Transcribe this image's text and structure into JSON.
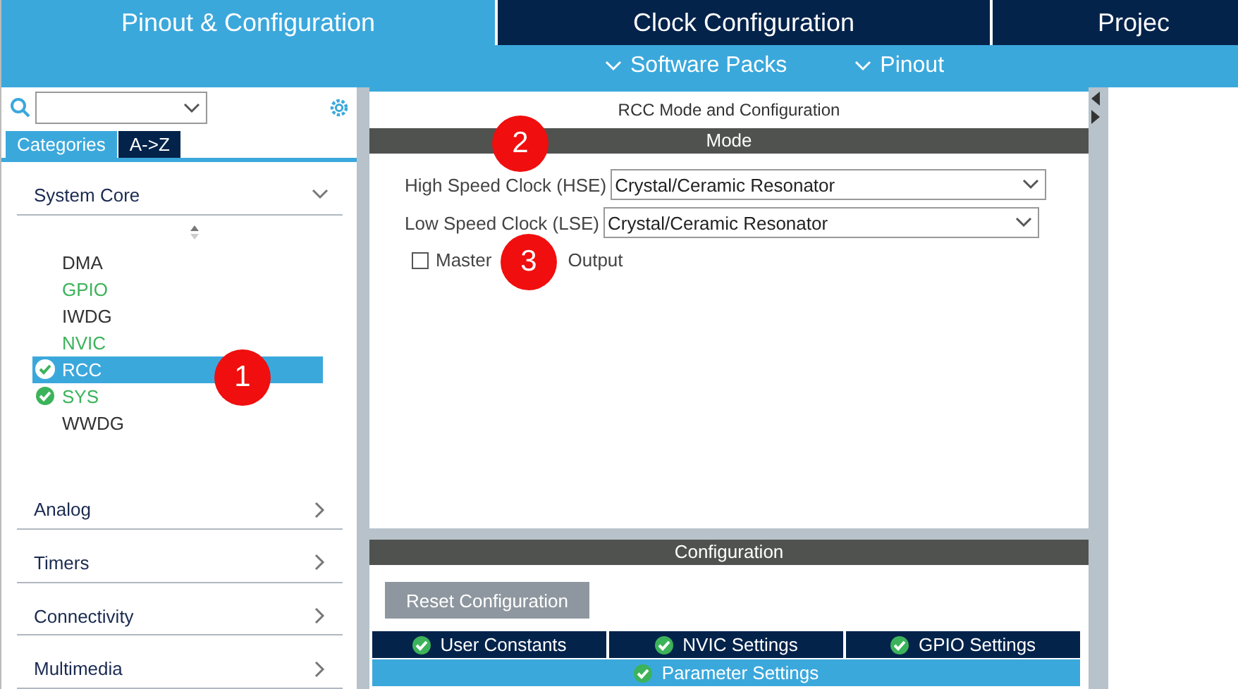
{
  "main_tabs": [
    {
      "label": "Pinout & Configuration",
      "selected": true
    },
    {
      "label": "Clock Configuration",
      "selected": false
    },
    {
      "label": "Projec",
      "selected": false
    }
  ],
  "sub_menu": [
    "Software Packs",
    "Pinout"
  ],
  "sidebar": {
    "view_tabs": [
      {
        "label": "Categories",
        "selected": true
      },
      {
        "label": "A->Z",
        "selected": false
      }
    ],
    "categories": [
      {
        "label": "System Core",
        "expanded": true,
        "items": [
          {
            "label": "DMA",
            "configured": false,
            "enabled": false,
            "selected": false
          },
          {
            "label": "GPIO",
            "configured": false,
            "enabled": true,
            "selected": false
          },
          {
            "label": "IWDG",
            "configured": false,
            "enabled": false,
            "selected": false
          },
          {
            "label": "NVIC",
            "configured": false,
            "enabled": true,
            "selected": false
          },
          {
            "label": "RCC",
            "configured": true,
            "enabled": true,
            "selected": true
          },
          {
            "label": "SYS",
            "configured": true,
            "enabled": true,
            "selected": false
          },
          {
            "label": "WWDG",
            "configured": false,
            "enabled": false,
            "selected": false
          }
        ]
      },
      {
        "label": "Analog",
        "expanded": false
      },
      {
        "label": "Timers",
        "expanded": false
      },
      {
        "label": "Connectivity",
        "expanded": false
      },
      {
        "label": "Multimedia",
        "expanded": false
      }
    ]
  },
  "panel": {
    "title": "RCC Mode and Configuration",
    "mode_header": "Mode",
    "fields": [
      {
        "label": "High Speed Clock (HSE)",
        "value": "Crystal/Ceramic Resonator"
      },
      {
        "label": "Low Speed Clock (LSE)",
        "value": "Crystal/Ceramic Resonator"
      }
    ],
    "checkbox": {
      "label_parts": [
        "Master",
        "Output"
      ],
      "checked": false
    },
    "config_header": "Configuration",
    "reset_button": "Reset Configuration",
    "config_tabs": [
      {
        "label": "User Constants",
        "selected": false
      },
      {
        "label": "NVIC Settings",
        "selected": false
      },
      {
        "label": "GPIO Settings",
        "selected": false
      },
      {
        "label": "Parameter Settings",
        "selected": true
      }
    ]
  },
  "annotations": [
    "1",
    "2",
    "3"
  ]
}
